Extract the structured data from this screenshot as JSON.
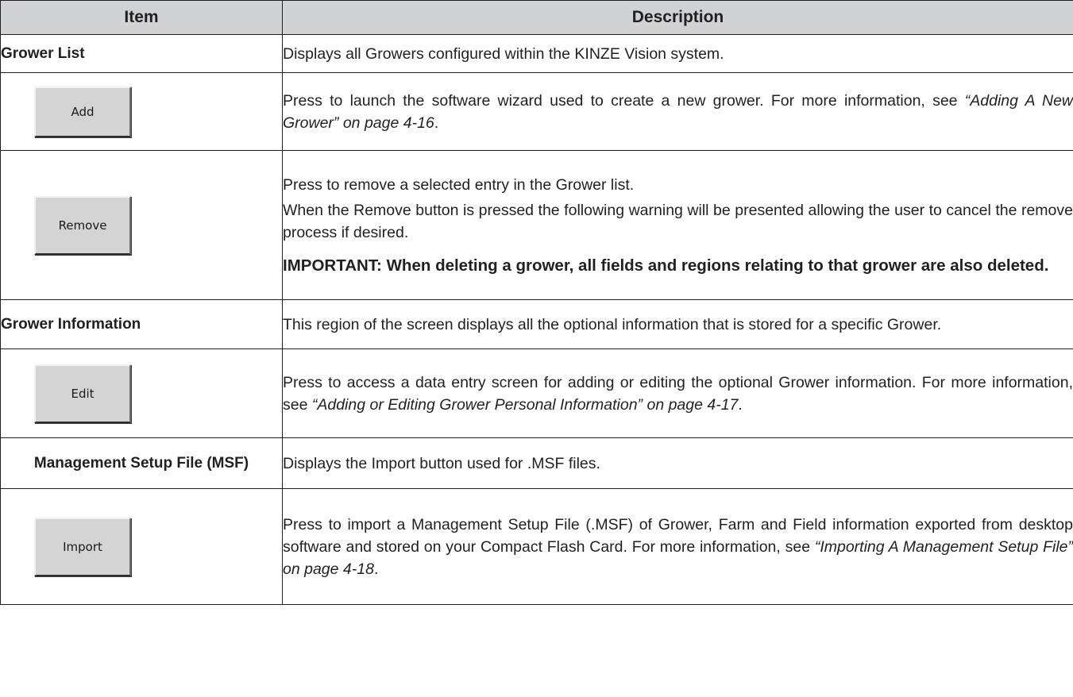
{
  "header": {
    "item": "Item",
    "description": "Description"
  },
  "rows": {
    "grower_list": {
      "item": "Grower List",
      "description": "Displays all Growers configured within the KINZE Vision system."
    },
    "add": {
      "button": "Add",
      "text": "Press to launch the software wizard used to create a new grower. For more information, see ",
      "ref": "“Adding A New Grower” on page 4-16",
      "end": "."
    },
    "remove": {
      "button": "Remove",
      "p1": "Press to remove a selected entry in the Grower list.",
      "p2": "When the Remove button is pressed the following warning will be presented allowing the user to cancel the remove process if desired.",
      "important": "IMPORTANT: When deleting a grower, all fields and regions relating to that grower are also deleted."
    },
    "grower_info": {
      "item": "Grower Information",
      "description": "This region of the screen displays all the optional information that is stored for a specific Grower."
    },
    "edit": {
      "button": "Edit",
      "text": "Press to access a data entry screen for adding or editing the optional Grower information. For more information, see ",
      "ref": "“Adding or Editing Grower Personal Information” on page 4-17",
      "end": "."
    },
    "msf": {
      "item": "Management Setup File (MSF)",
      "description": "Displays the Import button used for .MSF files."
    },
    "import": {
      "button": "Import",
      "text": "Press to import a Management Setup File (.MSF) of Grower, Farm and Field information exported from desktop software and stored on your Compact Flash Card. For more information, see ",
      "ref": "“Importing A Management Setup File” on page 4-18",
      "end": "."
    }
  }
}
